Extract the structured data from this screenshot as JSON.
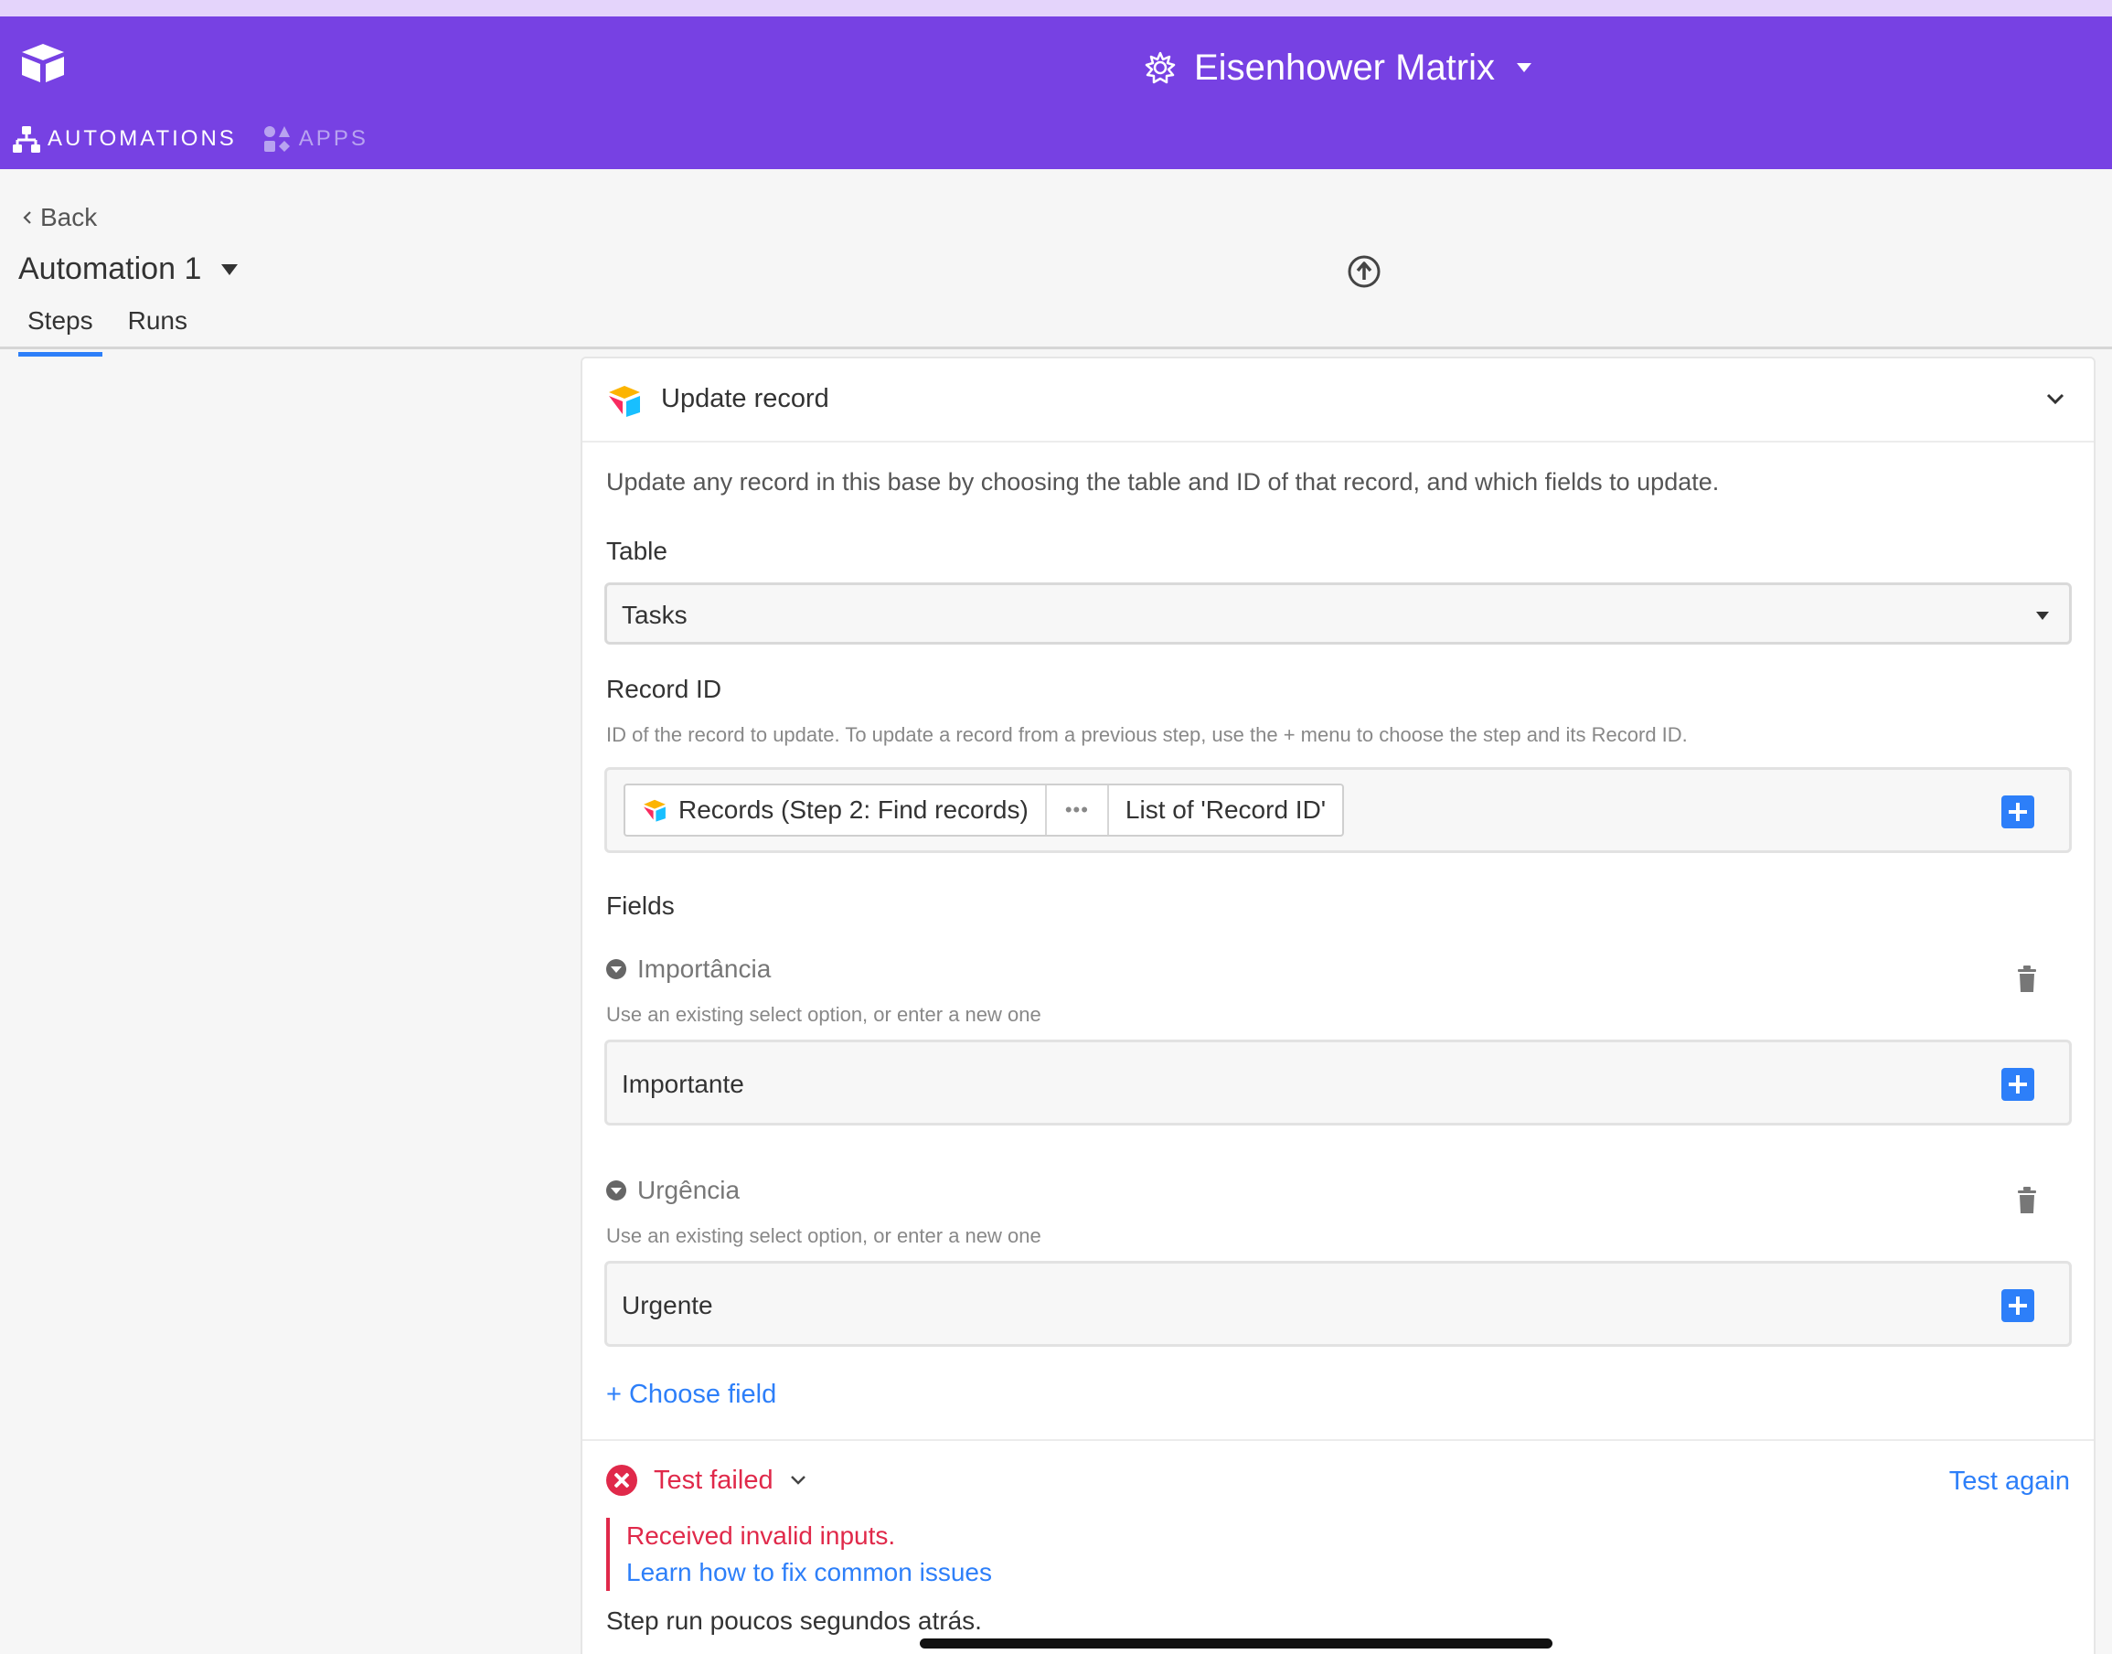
{
  "header": {
    "base_name": "Eisenhower Matrix",
    "nav": [
      {
        "label": "AUTOMATIONS",
        "icon": "automations-icon"
      },
      {
        "label": "APPS",
        "icon": "apps-icon"
      }
    ]
  },
  "page": {
    "back_label": "Back",
    "automation_name": "Automation 1",
    "tabs": [
      "Steps",
      "Runs"
    ],
    "active_tab": "Steps"
  },
  "step": {
    "title": "Update record",
    "description": "Update any record in this base by choosing the table and ID of that record, and which fields to update.",
    "table": {
      "label": "Table",
      "value": "Tasks"
    },
    "record_id": {
      "label": "Record ID",
      "help": "ID of the record to update. To update a record from a previous step, use the + menu to choose the step and its Record ID.",
      "token_source": "Records (Step 2: Find records)",
      "token_dots": "•••",
      "token_value": "List of 'Record ID'"
    },
    "fields_label": "Fields",
    "fields": [
      {
        "name": "Importância",
        "help": "Use an existing select option, or enter a new one",
        "value": "Importante"
      },
      {
        "name": "Urgência",
        "help": "Use an existing select option, or enter a new one",
        "value": "Urgente"
      }
    ],
    "choose_field": "+ Choose field"
  },
  "test": {
    "status": "Test failed",
    "again": "Test again",
    "error": "Received invalid inputs.",
    "help_link": "Learn how to fix common issues",
    "run_time": "Step run poucos segundos atrás."
  },
  "colors": {
    "header": "#7741e3",
    "accent": "#2d7ff9",
    "error": "#e0294a"
  }
}
